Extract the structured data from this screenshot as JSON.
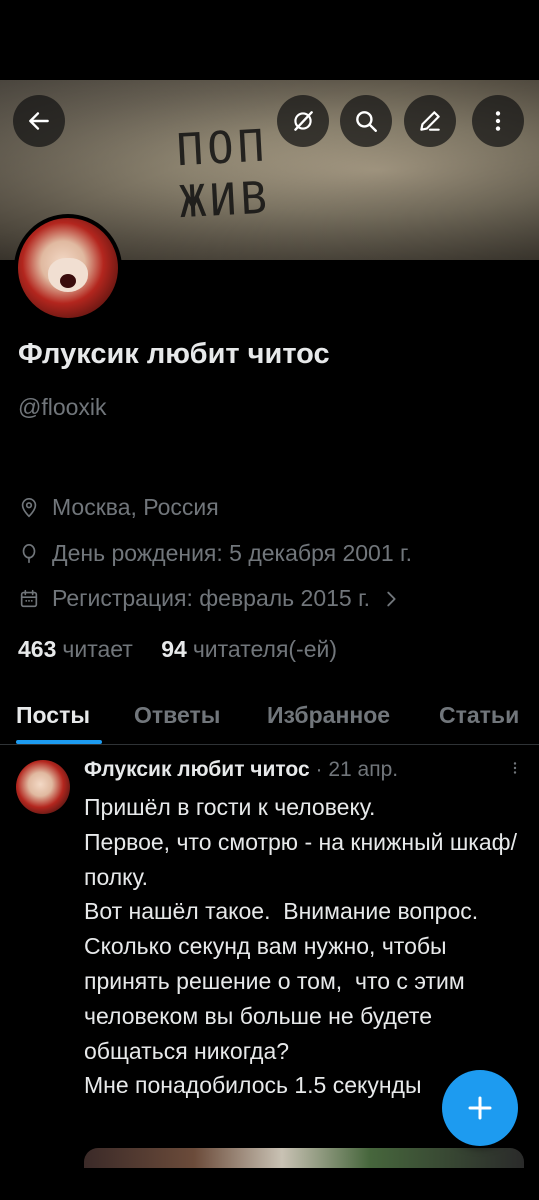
{
  "header": {
    "banner_text_line1": "ПОП",
    "banner_text_line2": "ЖИВ",
    "back_icon": "arrow-left-icon",
    "actions": [
      "grok-icon",
      "search-icon",
      "edit-icon",
      "more-vertical-icon"
    ]
  },
  "profile": {
    "display_name": "Флуксик любит читос",
    "handle": "@flooxik",
    "location": "Москва, Россия",
    "birthday": "День рождения: 5 декабря 2001 г.",
    "joined": "Регистрация: февраль 2015 г.",
    "following_count": "463",
    "following_label": "читает",
    "followers_count": "94",
    "followers_label": "читателя(-ей)"
  },
  "tabs": [
    {
      "label": "Посты",
      "active": true
    },
    {
      "label": "Ответы",
      "active": false
    },
    {
      "label": "Избранное",
      "active": false
    },
    {
      "label": "Статьи",
      "active": false
    }
  ],
  "post": {
    "author": "Флуксик любит читос",
    "separator": "·",
    "date": "21 апр.",
    "text": "Пришёл в гости к человеку.\nПервое, что смотрю - на книжный шкаф/полку.\nВот нашёл такое.  Внимание вопрос.\nСколько секунд вам нужно, чтобы принять решение о том,  что с этим человеком вы больше не будете общаться никогда?\nМне понадобилось 1.5 секунды"
  },
  "fab": {
    "icon": "plus-icon"
  },
  "colors": {
    "accent": "#1d9bf0",
    "text": "#e7e9ea",
    "muted": "#71767b",
    "background": "#000000"
  }
}
